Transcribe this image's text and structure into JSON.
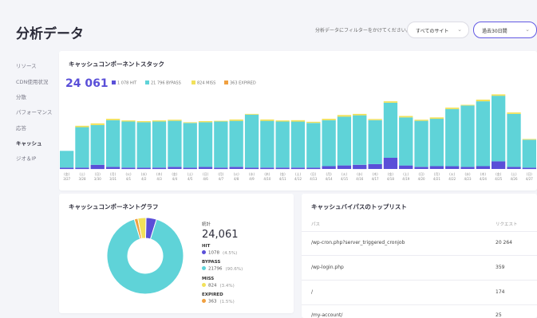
{
  "header": {
    "title": "分析データ",
    "filter_label": "分析データにフィルターをかけてください。",
    "site_select": "すべてのサイト",
    "period_select": "過去30日間"
  },
  "sidebar": {
    "items": [
      {
        "label": "リソース",
        "active": false
      },
      {
        "label": "CDN使用状況",
        "active": false
      },
      {
        "label": "分散",
        "active": false
      },
      {
        "label": "パフォーマンス",
        "active": false
      },
      {
        "label": "応答",
        "active": false
      },
      {
        "label": "キャッシュ",
        "active": true
      },
      {
        "label": "ジオ＆IP",
        "active": false
      }
    ]
  },
  "stack_card": {
    "title": "キャッシュコンポーネントスタック",
    "total": "24 061",
    "legend": [
      {
        "label": "1 078 HIT",
        "color": "#5a4fd8"
      },
      {
        "label": "21 796 BYPASS",
        "color": "#5fd3d8"
      },
      {
        "label": "824 MISS",
        "color": "#f2e15a"
      },
      {
        "label": "363 EXPIRED",
        "color": "#f0a040"
      }
    ]
  },
  "chart_data": {
    "type": "bar",
    "stacked": true,
    "categories": [
      [
        "(金)",
        "3/27"
      ],
      [
        "(土)",
        "3/28"
      ],
      [
        "(日)",
        "3/30"
      ],
      [
        "(月)",
        "3/31"
      ],
      [
        "(火)",
        "4/1"
      ],
      [
        "(水)",
        "4/2"
      ],
      [
        "(木)",
        "4/3"
      ],
      [
        "(金)",
        "4/4"
      ],
      [
        "(土)",
        "4/5"
      ],
      [
        "(日)",
        "4/6"
      ],
      [
        "(月)",
        "4/7"
      ],
      [
        "(火)",
        "4/8"
      ],
      [
        "(水)",
        "4/9"
      ],
      [
        "(木)",
        "4/10"
      ],
      [
        "(金)",
        "4/11"
      ],
      [
        "(土)",
        "4/12"
      ],
      [
        "(日)",
        "4/13"
      ],
      [
        "(月)",
        "4/14"
      ],
      [
        "(火)",
        "4/15"
      ],
      [
        "(水)",
        "4/16"
      ],
      [
        "(木)",
        "4/17"
      ],
      [
        "(金)",
        "4/18"
      ],
      [
        "(土)",
        "4/19"
      ],
      [
        "(日)",
        "4/20"
      ],
      [
        "(月)",
        "4/21"
      ],
      [
        "(火)",
        "4/22"
      ],
      [
        "(水)",
        "4/23"
      ],
      [
        "(木)",
        "4/24"
      ],
      [
        "(金)",
        "4/25"
      ],
      [
        "(土)",
        "4/26"
      ],
      [
        "(日)",
        "4/27"
      ]
    ],
    "series": [
      {
        "name": "HIT",
        "color": "#5a4fd8",
        "values": [
          10,
          10,
          30,
          15,
          10,
          10,
          10,
          15,
          10,
          15,
          10,
          15,
          10,
          10,
          10,
          10,
          10,
          20,
          25,
          30,
          35,
          80,
          25,
          15,
          20,
          20,
          15,
          20,
          55,
          15,
          10
        ]
      },
      {
        "name": "BYPASS",
        "color": "#5fd3d8",
        "values": [
          120,
          290,
          285,
          335,
          330,
          325,
          330,
          330,
          320,
          320,
          330,
          330,
          380,
          335,
          330,
          330,
          320,
          330,
          350,
          355,
          315,
          395,
          345,
          330,
          340,
          410,
          440,
          465,
          470,
          380,
          200
        ]
      },
      {
        "name": "MISS",
        "color": "#f2e15a",
        "values": [
          0,
          10,
          12,
          10,
          8,
          8,
          8,
          8,
          5,
          8,
          5,
          10,
          5,
          10,
          8,
          10,
          8,
          10,
          12,
          10,
          8,
          10,
          10,
          8,
          10,
          10,
          5,
          12,
          10,
          10,
          5
        ]
      },
      {
        "name": "EXPIRED",
        "color": "#f0a040",
        "values": [
          0,
          0,
          0,
          0,
          0,
          0,
          0,
          0,
          0,
          0,
          0,
          0,
          0,
          0,
          0,
          0,
          0,
          0,
          0,
          0,
          0,
          0,
          0,
          0,
          0,
          0,
          0,
          0,
          0,
          0,
          0
        ]
      }
    ],
    "ylim": [
      0,
      560
    ]
  },
  "graph_card": {
    "title": "キャッシュコンポーネントグラフ",
    "total_label": "統計",
    "total": "24,061",
    "stats": [
      {
        "label": "HIT",
        "value": "1078",
        "pct": "(4.5%)",
        "color": "#5a4fd8",
        "num": 1078
      },
      {
        "label": "BYPASS",
        "value": "21796",
        "pct": "(90.6%)",
        "color": "#5fd3d8",
        "num": 21796
      },
      {
        "label": "MISS",
        "value": "824",
        "pct": "(3.4%)",
        "color": "#f2e15a",
        "num": 824
      },
      {
        "label": "EXPIRED",
        "value": "363",
        "pct": "(1.5%)",
        "color": "#f0a040",
        "num": 363
      }
    ]
  },
  "bypass_card": {
    "title": "キャッシュバイパスのトップリスト",
    "col_path": "パス",
    "col_requests": "リクエスト",
    "rows": [
      {
        "path": "/wp-cron.php?server_triggered_cronjob",
        "requests": "20 264"
      },
      {
        "path": "/wp-login.php",
        "requests": "359"
      },
      {
        "path": "/",
        "requests": "174"
      },
      {
        "path": "/my-account/",
        "requests": "25"
      }
    ]
  }
}
